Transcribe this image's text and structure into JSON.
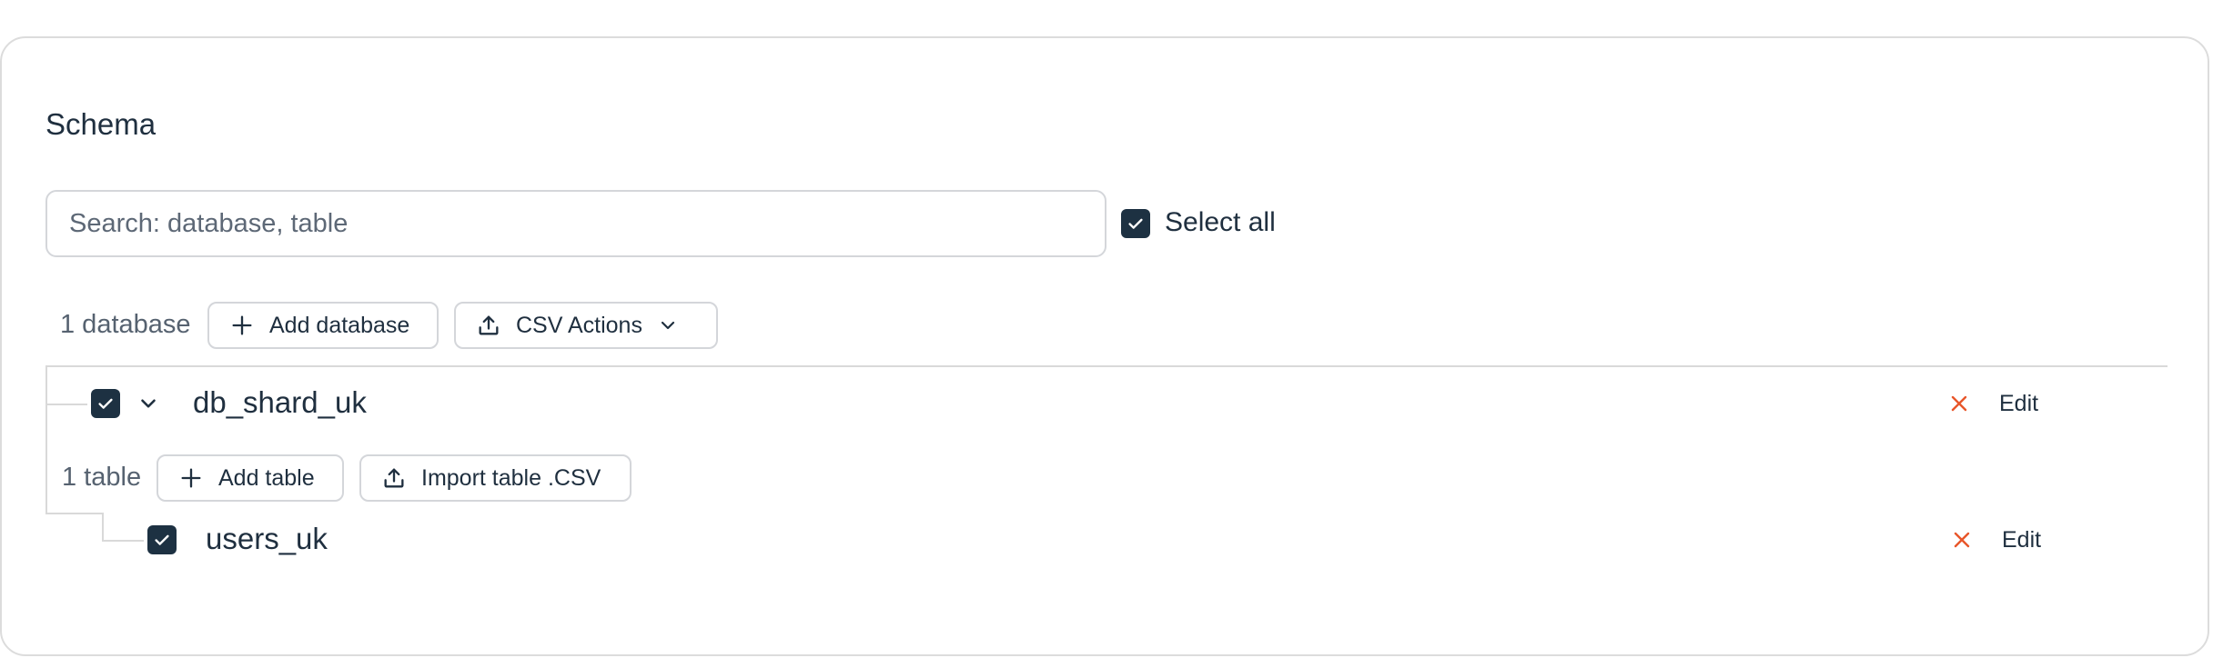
{
  "schema": {
    "title": "Schema",
    "search": {
      "placeholder": "Search: database, table",
      "value": ""
    },
    "select_all": {
      "label": "Select all",
      "checked": true
    },
    "databases_count_label": "1 database",
    "add_database_label": "Add database",
    "csv_actions_label": "CSV Actions",
    "databases": [
      {
        "name": "db_shard_uk",
        "checked": true,
        "expanded": true,
        "edit_label": "Edit",
        "tables_count_label": "1 table",
        "add_table_label": "Add table",
        "import_table_label": "Import table .CSV",
        "tables": [
          {
            "name": "users_uk",
            "checked": true,
            "edit_label": "Edit"
          }
        ]
      }
    ]
  },
  "icons": {
    "check": "check-icon",
    "plus": "plus-icon",
    "upload": "upload-icon",
    "chevron": "chevron-down-icon",
    "close": "close-icon"
  },
  "colors": {
    "checkbox_fill": "#1d3142",
    "close_icon": "#e8562a",
    "border": "#d4d6da",
    "tree_line": "#d9d9d9",
    "text": "#1f2f3f"
  }
}
